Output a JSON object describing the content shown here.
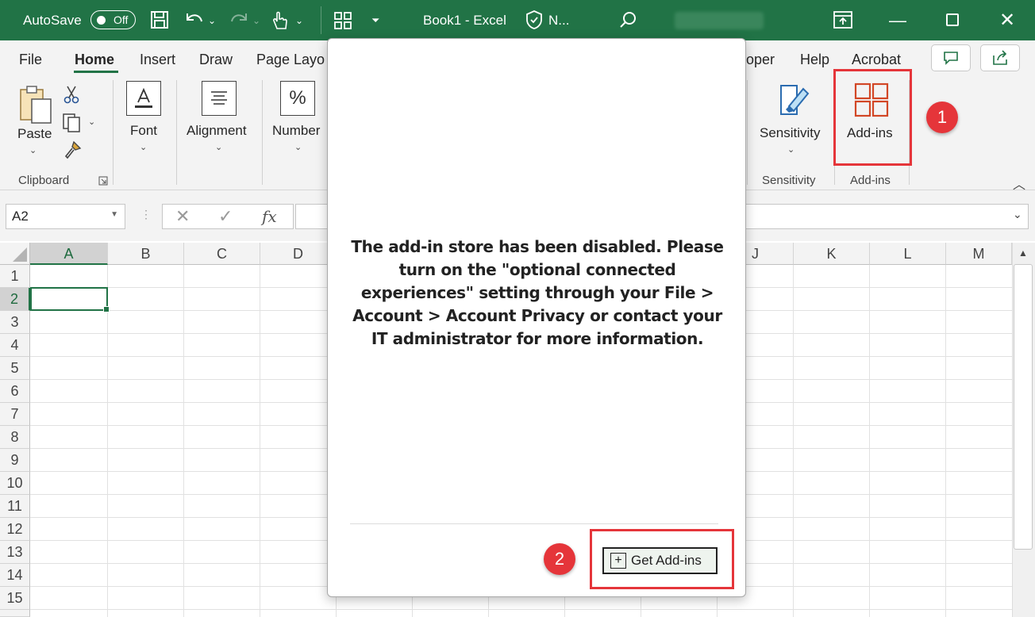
{
  "titlebar": {
    "autosave_label": "AutoSave",
    "autosave_state": "Off",
    "doc_title": "Book1  -  Excel",
    "sensitivity_short": "N..."
  },
  "tabs": [
    "File",
    "Home",
    "Insert",
    "Draw",
    "Page Layo",
    "oper",
    "Help",
    "Acrobat"
  ],
  "ribbon": {
    "clipboard": {
      "paste": "Paste",
      "group": "Clipboard"
    },
    "font": "Font",
    "alignment": "Alignment",
    "number": "Number",
    "number_symbol": "%",
    "sensitivity": {
      "button": "Sensitivity",
      "group": "Sensitivity"
    },
    "addins": {
      "button": "Add-ins",
      "group": "Add-ins"
    }
  },
  "formula_bar": {
    "name_box": "A2",
    "fx": "fx"
  },
  "columns": [
    "A",
    "B",
    "C",
    "D",
    "J",
    "K",
    "L",
    "M"
  ],
  "rows": [
    "1",
    "2",
    "3",
    "4",
    "5",
    "6",
    "7",
    "8",
    "9",
    "10",
    "11",
    "12",
    "13",
    "14",
    "15"
  ],
  "dialog": {
    "message": "The add-in store has been disabled. Please turn on the \"optional connected experiences\" setting through your File > Account > Account Privacy or contact your IT administrator for more information.",
    "button_label": "Get Add-ins"
  },
  "annotations": {
    "step1": "1",
    "step2": "2"
  },
  "colors": {
    "excel_green": "#217346",
    "annotation_red": "#e5353a",
    "addins_orange": "#d24726"
  }
}
